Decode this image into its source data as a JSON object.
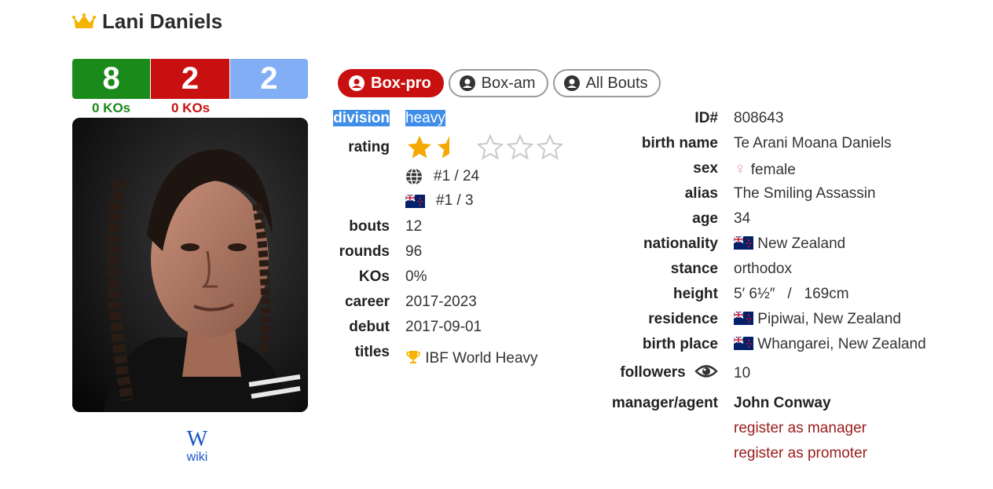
{
  "header": {
    "name": "Lani Daniels"
  },
  "record": {
    "wins": "8",
    "losses": "2",
    "draws": "2",
    "win_kos": "0 KOs",
    "loss_kos": "0 KOs",
    "colors": {
      "win": "#1a8a1a",
      "loss": "#c81010",
      "draw": "#82aef5"
    }
  },
  "wiki": {
    "glyph": "W",
    "label": "wiki"
  },
  "tabs": [
    {
      "label": "Box-pro",
      "active": true
    },
    {
      "label": "Box-am",
      "active": false
    },
    {
      "label": "All Bouts",
      "active": false
    }
  ],
  "left_details": {
    "division": {
      "label": "division",
      "value": "heavy"
    },
    "rating": {
      "label": "rating",
      "stars": 1.5,
      "max": 5,
      "world_rank": "#1 / 24",
      "country_rank": "#1 / 3"
    },
    "bouts": {
      "label": "bouts",
      "value": "12"
    },
    "rounds": {
      "label": "rounds",
      "value": "96"
    },
    "kos": {
      "label": "KOs",
      "value": "0%"
    },
    "career": {
      "label": "career",
      "value": "2017-2023"
    },
    "debut": {
      "label": "debut",
      "value": "2017-09-01"
    },
    "titles": {
      "label": "titles",
      "value": "IBF World Heavy"
    }
  },
  "right_details": {
    "id": {
      "label": "ID#",
      "value": "808643"
    },
    "birth_name": {
      "label": "birth name",
      "value": "Te Arani Moana Daniels"
    },
    "sex": {
      "label": "sex",
      "value": "female"
    },
    "alias": {
      "label": "alias",
      "value": "The Smiling Assassin"
    },
    "age": {
      "label": "age",
      "value": "34"
    },
    "nationality": {
      "label": "nationality",
      "value": "New Zealand"
    },
    "stance": {
      "label": "stance",
      "value": "orthodox"
    },
    "height": {
      "label": "height",
      "value": "5′ 6½″   /   169cm"
    },
    "residence": {
      "label": "residence",
      "value": "Pipiwai, New Zealand"
    },
    "birth_place": {
      "label": "birth place",
      "value": "Whangarei, New Zealand"
    },
    "followers": {
      "label": "followers",
      "value": "10"
    },
    "manager": {
      "label": "manager/agent",
      "value": "John Conway"
    },
    "register_manager": "register as manager",
    "register_promoter": "register as promoter"
  },
  "icons": {
    "crown": "crown-icon",
    "globe": "globe-icon",
    "flag": "nz-flag-icon",
    "trophy": "trophy-icon",
    "eye": "eye-icon",
    "user": "user-circle-icon",
    "venus": "venus-icon"
  }
}
